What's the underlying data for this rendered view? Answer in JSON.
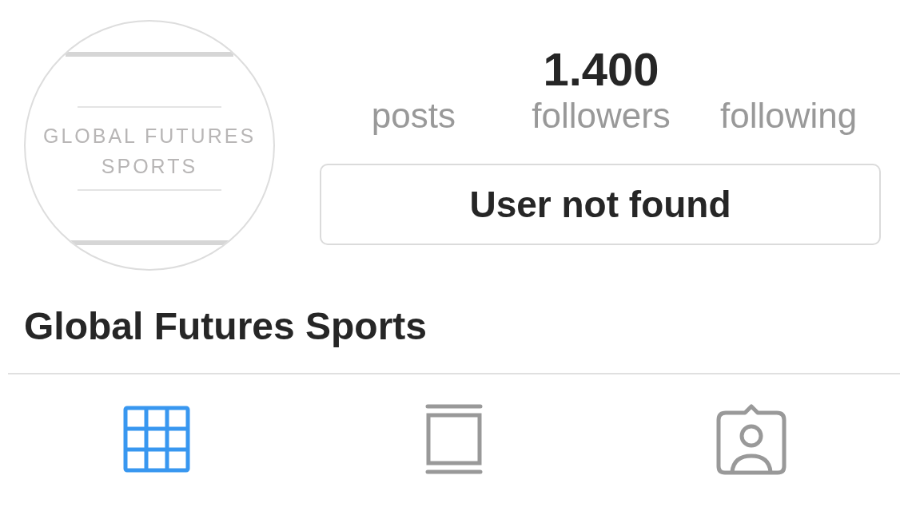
{
  "profile": {
    "avatar": {
      "logo_lines": [
        "GLOBAL FUTURES",
        "SPORTS"
      ]
    },
    "stats": [
      {
        "label": "posts"
      },
      {
        "value": "1.400",
        "label": "followers"
      },
      {
        "label": "following"
      }
    ],
    "action_button": "User not found",
    "name": "Global Futures Sports"
  },
  "tabs": [
    {
      "kind": "grid",
      "selected": true
    },
    {
      "kind": "feed",
      "selected": false
    },
    {
      "kind": "tagged",
      "selected": false
    }
  ]
}
